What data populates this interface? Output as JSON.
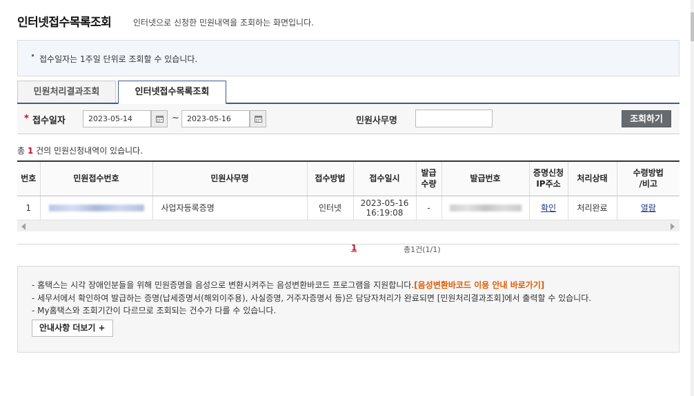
{
  "page": {
    "title": "인터넷접수목록조회",
    "subtitle": "인터넷으로 신청한 민원내역을 조회하는 화면입니다."
  },
  "notice": {
    "text": "접수일자는 1주일 단위로 조회할 수 있습니다."
  },
  "tabs": [
    {
      "label": "민원처리결과조회",
      "active": false
    },
    {
      "label": "인터넷접수목록조회",
      "active": true
    }
  ],
  "search": {
    "date_label": "접수일자",
    "required_mark": "*",
    "start_date": "2023-05-14",
    "end_date": "2023-05-16",
    "range_separator": "~",
    "service_label": "민원사무명",
    "service_value": "",
    "search_button": "조회하기"
  },
  "results": {
    "prefix": "총",
    "count": "1",
    "suffix": "건의 민원신청내역이 있습니다."
  },
  "table": {
    "headers": [
      "번호",
      "민원접수번호",
      "민원사무명",
      "접수방법",
      "접수일시",
      "발급\n수량",
      "발급번호",
      "증명신청\nIP주소",
      "처리상태",
      "수령방법\n/비고"
    ],
    "rows": [
      {
        "no": "1",
        "receipt_no": "",
        "service": "사업자등록증명",
        "method": "인터넷",
        "date": "2023-05-16",
        "time": "16:19:08",
        "qty": "-",
        "issue_no": "",
        "ip": "확인",
        "status": "처리완료",
        "receive": "열람"
      }
    ]
  },
  "pagination": {
    "current": "1",
    "total": "총1건(1/1)"
  },
  "guide": {
    "line1_text": "- 홈택스는 시각 장애인분들을 위해 민원증명을 음성으로 변환시켜주는 음성변환바코드 프로그램을 지원합니다.",
    "line1_link": "[음성변환바코드 이용 안내 바로가기]",
    "line2": "- 세무서에서 확인하여 발급하는 증명(납세증명서(해외이주용), 사실증명, 거주자증명서 등)은 담당자처리가 완료되면 [민원처리결과조회]에서 출력할 수 있습니다.",
    "line3": "- My홈택스와 조회기간이 다르므로 조회되는 건수가 다를 수 있습니다.",
    "more_button": "안내사항 더보기",
    "more_plus": "+"
  },
  "colors": {
    "tab_active_border": "#3d5a8a",
    "required": "#d0021b",
    "count_highlight": "#c8102e",
    "link": "#1a3a8a",
    "guide_link": "#e05a00",
    "search_button_bg": "#666b70"
  },
  "icons": {
    "calendar": "calendar-icon",
    "scroll_left": "arrow-left-icon",
    "scroll_right": "arrow-right-icon"
  }
}
